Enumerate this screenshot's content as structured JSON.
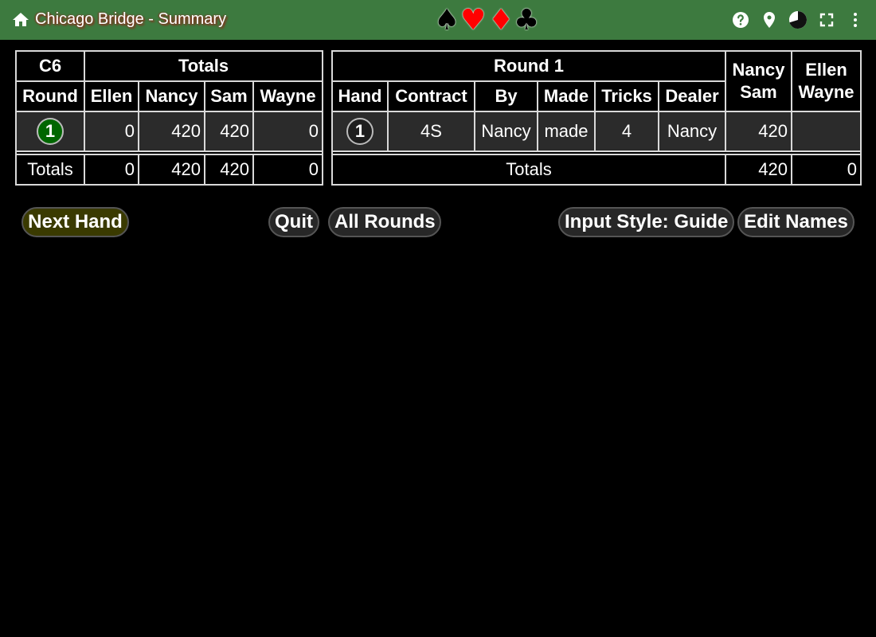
{
  "header": {
    "title": "Chicago Bridge - Summary",
    "suits": {
      "spade": "♠",
      "heart": "♥",
      "diamond": "♦",
      "club": "♣"
    },
    "colors": {
      "bar": "#3d7a3f",
      "red_suit": "#ff0000"
    },
    "icons": [
      "home-icon",
      "help-icon",
      "location-icon",
      "theme-icon",
      "fullscreen-icon",
      "more-vert-icon"
    ]
  },
  "totals_table": {
    "corner": "C6",
    "group_header": "Totals",
    "columns": [
      "Round",
      "Ellen",
      "Nancy",
      "Sam",
      "Wayne"
    ],
    "rows": [
      {
        "round": "1",
        "values": [
          "0",
          "420",
          "420",
          "0"
        ]
      }
    ],
    "totals_label": "Totals",
    "totals": [
      "0",
      "420",
      "420",
      "0"
    ]
  },
  "round_table": {
    "title": "Round 1",
    "pair1": [
      "Nancy",
      "Sam"
    ],
    "pair2": [
      "Ellen",
      "Wayne"
    ],
    "columns": [
      "Hand",
      "Contract",
      "By",
      "Made",
      "Tricks",
      "Dealer"
    ],
    "rows": [
      {
        "hand": "1",
        "contract": "4S",
        "by": "Nancy",
        "made": "made",
        "tricks": "4",
        "dealer": "Nancy",
        "pair1": "420",
        "pair2": ""
      }
    ],
    "totals_label": "Totals",
    "totals": [
      "420",
      "0"
    ]
  },
  "buttons": {
    "next_hand": "Next Hand",
    "quit": "Quit",
    "all_rounds": "All Rounds",
    "input_style": "Input Style: Guide",
    "edit_names": "Edit Names"
  }
}
